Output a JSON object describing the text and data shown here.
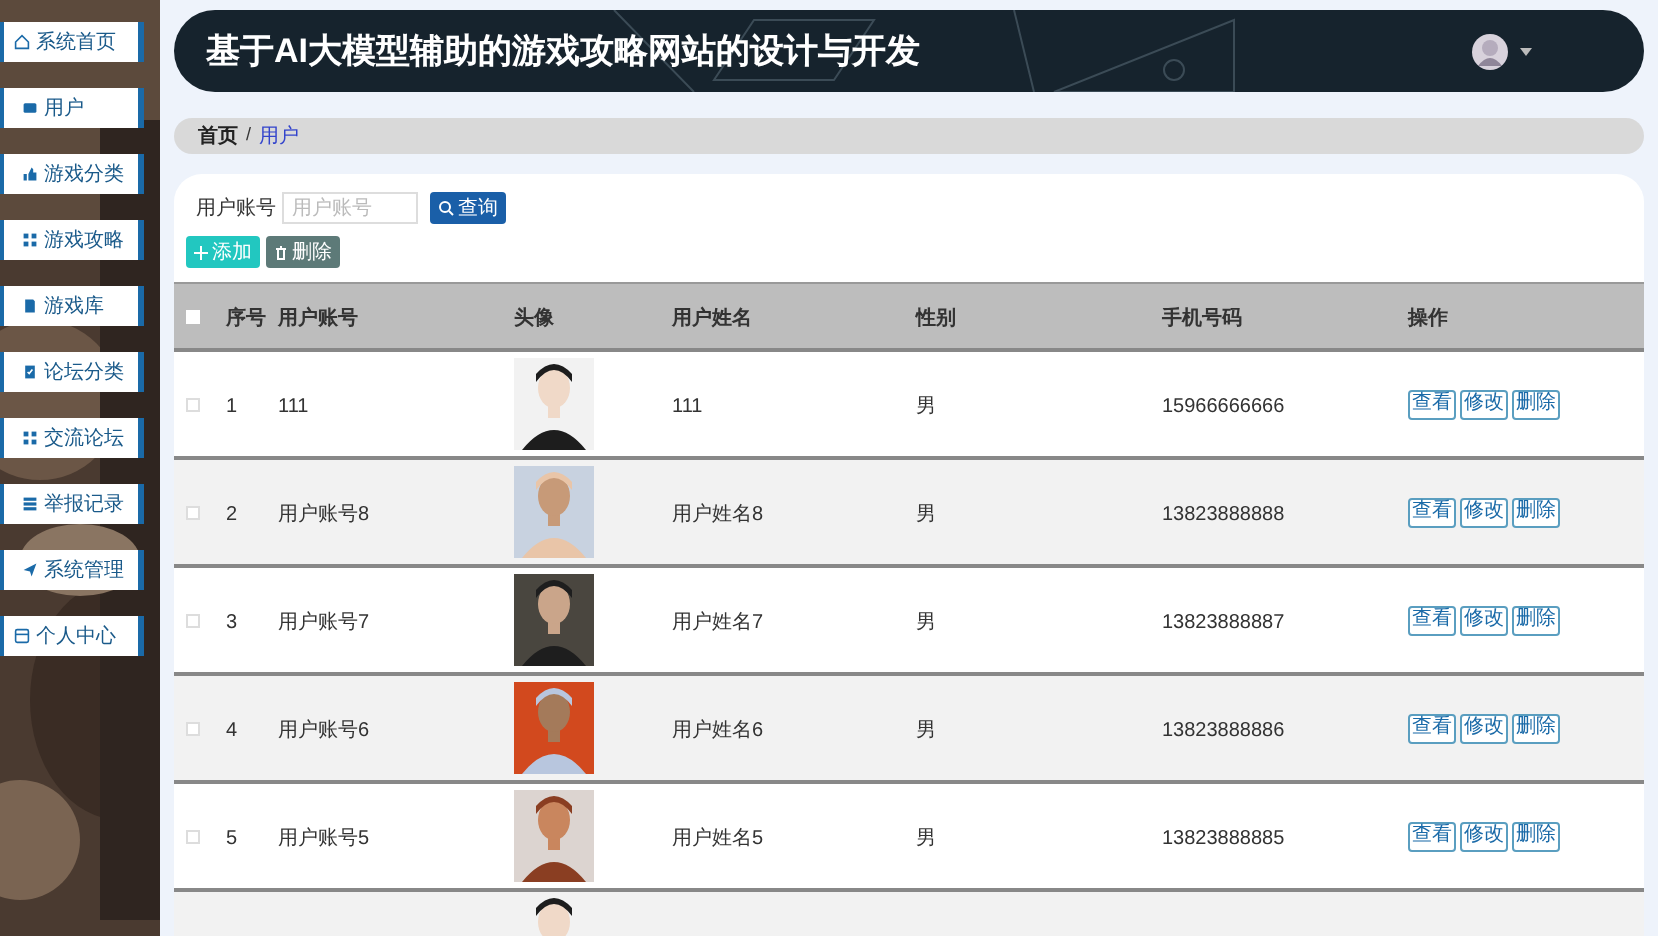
{
  "sidebar": {
    "items": [
      {
        "label": "系统首页"
      },
      {
        "label": "用户"
      },
      {
        "label": "游戏分类"
      },
      {
        "label": "游戏攻略"
      },
      {
        "label": "游戏库"
      },
      {
        "label": "论坛分类"
      },
      {
        "label": "交流论坛"
      },
      {
        "label": "举报记录"
      },
      {
        "label": "系统管理"
      },
      {
        "label": "个人中心"
      }
    ]
  },
  "header": {
    "title": "基于AI大模型辅助的游戏攻略网站的设计与开发"
  },
  "breadcrumb": {
    "separator": "/",
    "items": [
      {
        "label": "首页",
        "current": false
      },
      {
        "label": "用户",
        "current": true
      }
    ]
  },
  "search": {
    "label": "用户账号",
    "placeholder": "用户账号",
    "button": "查询"
  },
  "actions": [
    {
      "label": "添加",
      "kind": "add"
    },
    {
      "label": "删除",
      "kind": "delete"
    }
  ],
  "table": {
    "select_all_checked": false,
    "columns": [
      "序号",
      "用户账号",
      "头像",
      "用户姓名",
      "性别",
      "手机号码",
      "操作"
    ],
    "rows": [
      {
        "checked": false,
        "number": "1",
        "account": "111",
        "name": "111",
        "gender": "男",
        "phone": "15966666666",
        "buttons": [
          "查看",
          "修改",
          "删除"
        ]
      },
      {
        "checked": false,
        "number": "2",
        "account": "用户账号8",
        "name": "用户姓名8",
        "gender": "男",
        "phone": "13823888888",
        "buttons": [
          "查看",
          "修改",
          "删除"
        ]
      },
      {
        "checked": false,
        "number": "3",
        "account": "用户账号7",
        "name": "用户姓名7",
        "gender": "男",
        "phone": "13823888887",
        "buttons": [
          "查看",
          "修改",
          "删除"
        ]
      },
      {
        "checked": false,
        "number": "4",
        "account": "用户账号6",
        "name": "用户姓名6",
        "gender": "男",
        "phone": "13823888886",
        "buttons": [
          "查看",
          "修改",
          "删除"
        ]
      },
      {
        "checked": false,
        "number": "5",
        "account": "用户账号5",
        "name": "用户姓名5",
        "gender": "男",
        "phone": "13823888885",
        "buttons": [
          "查看",
          "修改",
          "删除"
        ]
      }
    ]
  }
}
